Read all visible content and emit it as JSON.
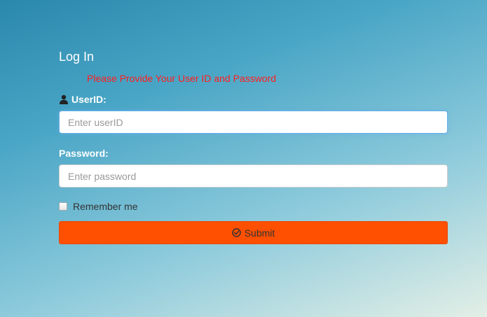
{
  "login": {
    "title": "Log In",
    "error_message": "Please Provide Your User ID and Password",
    "userid": {
      "label": "UserID:",
      "icon": "user-icon",
      "placeholder": "Enter userID",
      "value": ""
    },
    "password": {
      "label": "Password:",
      "placeholder": "Enter password",
      "value": ""
    },
    "remember": {
      "label": "Remember me",
      "checked": false
    },
    "submit": {
      "label": "Submit",
      "icon": "check-circle-icon",
      "color": "#ff4f00"
    }
  },
  "colors": {
    "error": "#ff1e1e",
    "accent": "#ff4f00",
    "focus_border": "#66afe9"
  }
}
